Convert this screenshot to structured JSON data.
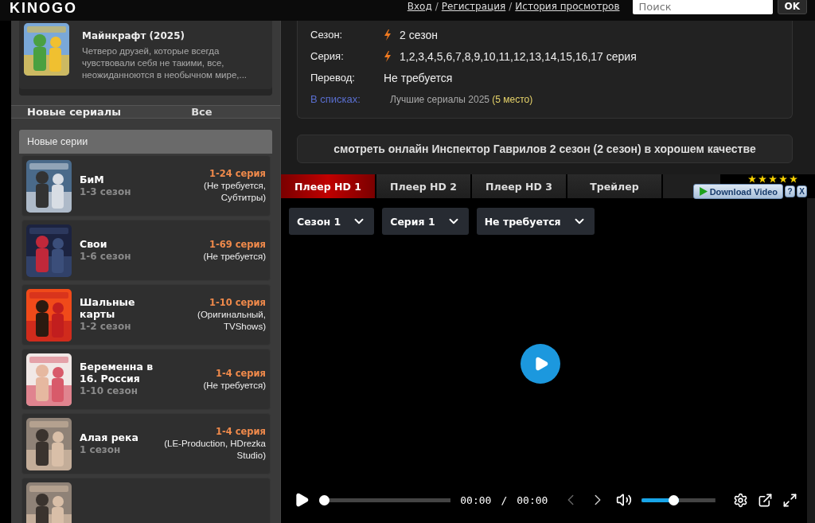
{
  "header": {
    "logo": "KINOGO",
    "links": [
      {
        "label": "Вход"
      },
      {
        "label": "Регистрация"
      },
      {
        "label": "История просмотров"
      }
    ],
    "separator": "/",
    "search": {
      "placeholder": "Поиск"
    },
    "search_button": "OK"
  },
  "sidebar": {
    "featured": {
      "title": "Майнкрафт (2025)",
      "description": "Четверо друзей, которые всегда чувствовали себя не такими, все, неожиданноются в необычном мире,..."
    },
    "section": {
      "title": "Новые сериалы",
      "link": "Все"
    },
    "list_title": "Новые серии",
    "items": [
      {
        "title": "БиМ",
        "seasons": "1-3 сезон",
        "episodes": "1-24 серия",
        "voice": "(Не требуется, Субтитры)"
      },
      {
        "title": "Свои",
        "seasons": "1-6 сезон",
        "episodes": "1-69 серия",
        "voice": "(Не требуется)"
      },
      {
        "title": "Шальные карты",
        "seasons": "1-2 сезон",
        "episodes": "1-10 серия",
        "voice": "(Оригинальный, TVShows)"
      },
      {
        "title": "Беременна в 16. Россия",
        "seasons": "1-10 сезон",
        "episodes": "1-4 серия",
        "voice": "(Не требуется)"
      },
      {
        "title": "Алая река",
        "seasons": "1 сезон",
        "episodes": "1-4 серия",
        "voice": "(LE-Production, HDrezka Studio)"
      }
    ]
  },
  "info": {
    "rows": [
      {
        "kind": "flash",
        "label": "Сезон:",
        "value": "2 сезон"
      },
      {
        "kind": "flash",
        "label": "Серия:",
        "value": "1,2,3,4,5,6,7,8,9,10,11,12,13,14,15,16,17 серия"
      },
      {
        "kind": "plain",
        "label": "Перевод:",
        "value": "Не требуется"
      }
    ],
    "lists": {
      "label": "В списках:",
      "value": "Лучшие сериалы 2025",
      "place": "(5 место)"
    }
  },
  "watch_title": "смотреть онлайн Инспектор Гаврилов 2 сезон (2 сезон) в хорошем качестве",
  "player_tabs": [
    {
      "label": "Плеер HD 1",
      "selected": true
    },
    {
      "label": "Плеер HD 2",
      "selected": false
    },
    {
      "label": "Плеер HD 3",
      "selected": false
    },
    {
      "label": "Трейлер",
      "selected": false
    }
  ],
  "rating": {
    "stars": 5
  },
  "download": {
    "label": "Download Video",
    "help": "?",
    "close": "X"
  },
  "player": {
    "selects": [
      {
        "label": "Сезон 1"
      },
      {
        "label": "Серия 1"
      },
      {
        "label": "Не требуется"
      }
    ],
    "progress": {
      "level": 0
    },
    "time": "00:00",
    "time_separator": "/",
    "duration": "00:00",
    "volume": {
      "level": 0.5
    }
  }
}
